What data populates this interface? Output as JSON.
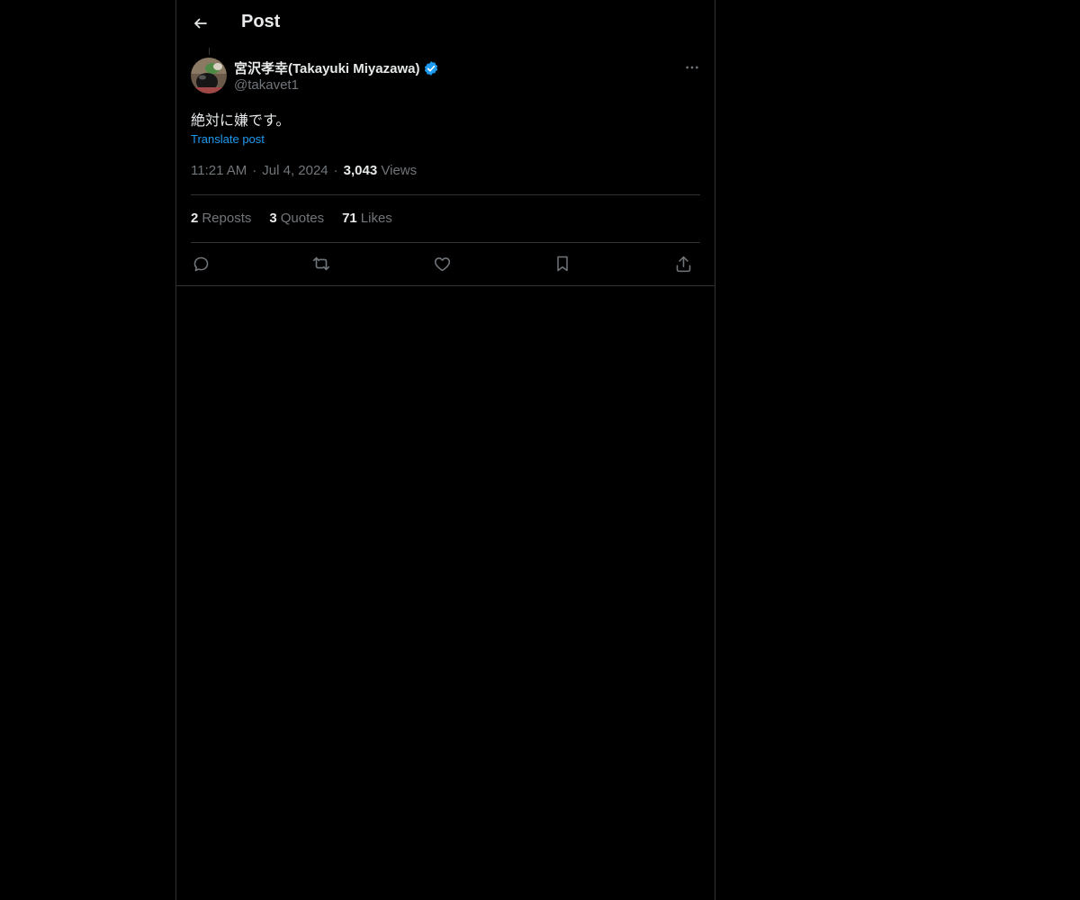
{
  "header": {
    "title": "Post",
    "back_icon": "arrow-left-icon"
  },
  "post": {
    "author": {
      "name": "宮沢孝幸(Takayuki Miyazawa)",
      "handle": "@takavet1",
      "verified": true
    },
    "text": "絶対に嫌です。",
    "translate_label": "Translate post",
    "time": "11:21 AM",
    "date": "Jul 4, 2024",
    "views_count": "3,043",
    "views_label": "Views",
    "stats": {
      "reposts_count": "2",
      "reposts_label": "Reposts",
      "quotes_count": "3",
      "quotes_label": "Quotes",
      "likes_count": "71",
      "likes_label": "Likes"
    }
  },
  "colors": {
    "background": "#000000",
    "text_primary": "#e7e9ea",
    "text_secondary": "#71767b",
    "accent": "#1d9bf0",
    "border": "#2f3336"
  },
  "icons": {
    "more": "more-horizontal-icon",
    "reply": "reply-icon",
    "repost": "repost-icon",
    "like": "heart-icon",
    "bookmark": "bookmark-icon",
    "share": "share-icon",
    "verified": "verified-badge-icon"
  }
}
